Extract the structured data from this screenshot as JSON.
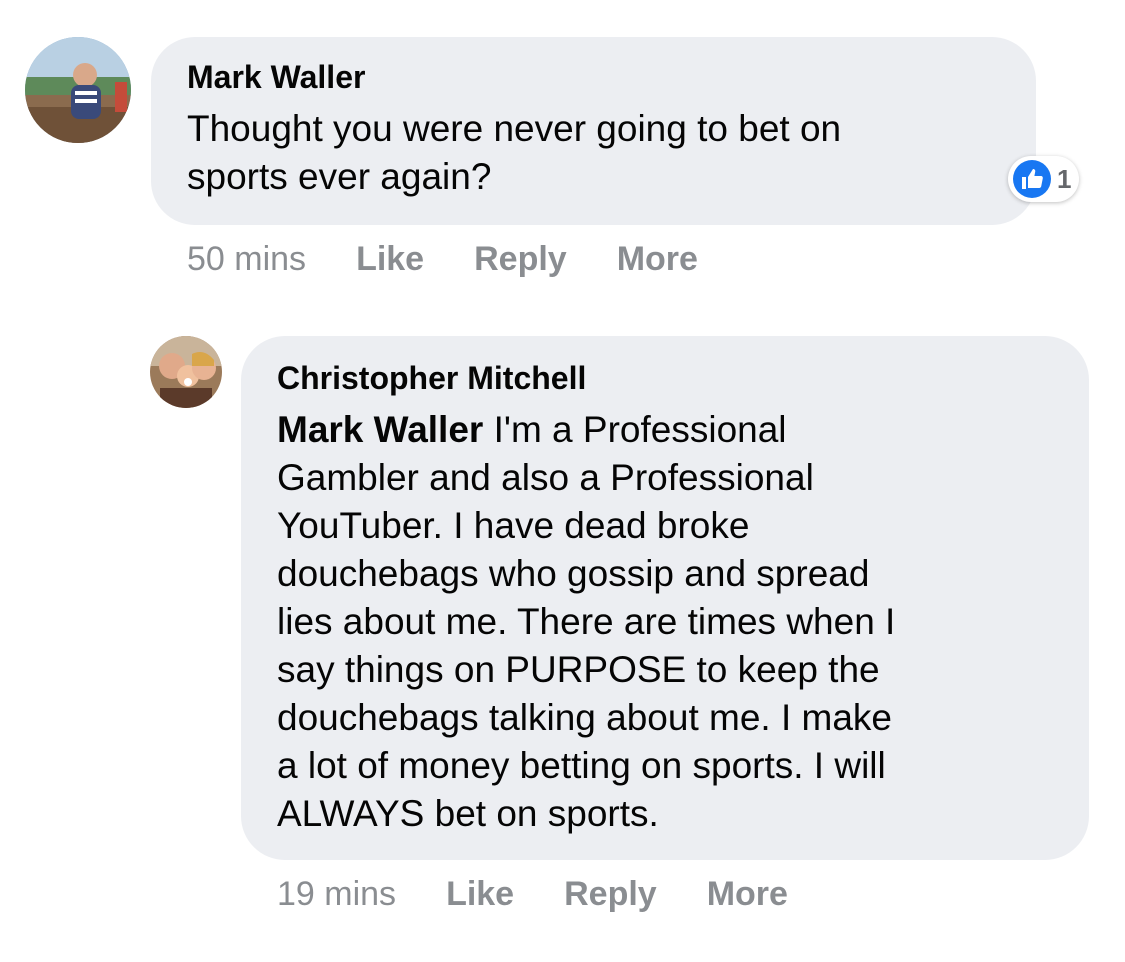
{
  "comments": [
    {
      "author": "Mark Waller",
      "text": "Thought you were never going to bet on\nsports ever again?",
      "reaction_count": "1",
      "reaction_icon": "like-icon",
      "time": "50 mins",
      "like_label": "Like",
      "reply_label": "Reply",
      "more_label": "More"
    },
    {
      "author": "Christopher Mitchell",
      "mention": "Mark Waller",
      "text": " I'm a Professional\nGambler and also a Professional\nYouTuber. I have dead broke\ndouchebags who gossip and spread\nlies about me. There are times when I\nsay things on PURPOSE to keep the\ndouchebags talking about me. I make\na lot of money betting on sports. I will\nALWAYS bet on sports.",
      "time": "19 mins",
      "like_label": "Like",
      "reply_label": "Reply",
      "more_label": "More"
    }
  ],
  "colors": {
    "bubble": "#eceef2",
    "meta": "#8a8d91",
    "like_blue": "#1877f2"
  }
}
